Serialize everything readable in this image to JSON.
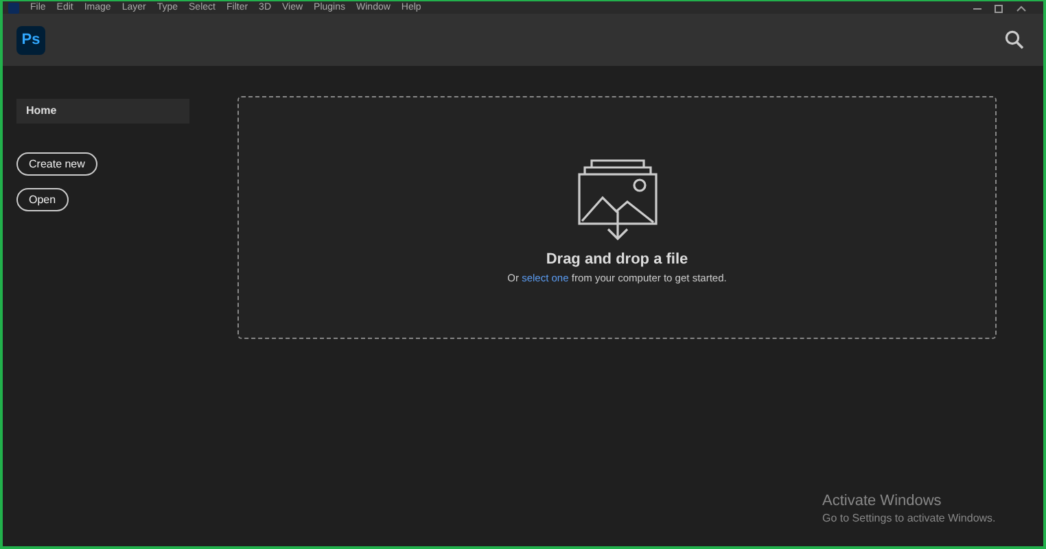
{
  "menu_bar": [
    "File",
    "Edit",
    "Image",
    "Layer",
    "Type",
    "Select",
    "Filter",
    "3D",
    "View",
    "Plugins",
    "Window",
    "Help"
  ],
  "app_logo": "Ps",
  "sidebar": {
    "items": [
      {
        "label": "Home",
        "selected": true
      }
    ],
    "buttons": [
      "Create new",
      "Open"
    ]
  },
  "drop_zone": {
    "title": "Drag and drop a file",
    "prefix": "Or",
    "link": "select one",
    "suffix": "from your computer to get started."
  },
  "watermark": {
    "title": "Activate Windows",
    "subtitle": "Go to Settings to activate Windows."
  }
}
